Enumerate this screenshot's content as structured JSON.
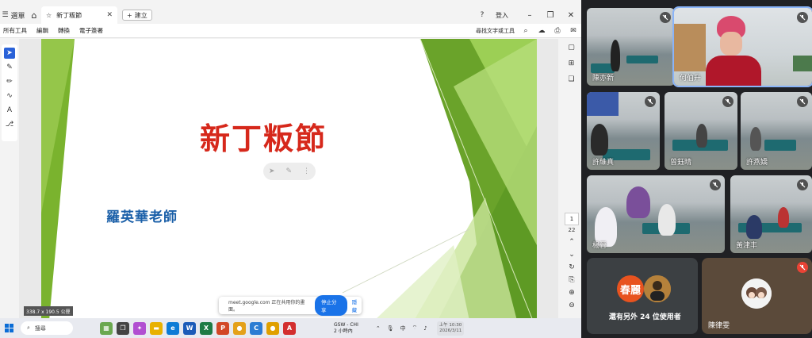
{
  "pdf": {
    "menu_label": "選單",
    "tab_title": "新丁粄節",
    "new_tab_label": "建立",
    "sign_in": "登入",
    "toolbar": {
      "all_tools": "所有工具",
      "edit": "編輯",
      "convert": "轉換",
      "esign": "電子簽署",
      "find_text": "尋找文字或工具"
    },
    "slide": {
      "title": "新丁粄節",
      "subtitle": "羅英華老師"
    },
    "page_current": "1",
    "page_total": "22",
    "dimensions": "338.7 x 190.5 公厘"
  },
  "share": {
    "message": "meet.google.com 正在共用你的畫面。",
    "stop_label": "停止分享",
    "hide_label": "隱藏"
  },
  "taskbar": {
    "search_label": "搜尋",
    "weather_line1": "GSW - CHI",
    "weather_line2": "2 小時內",
    "ime_label": "中",
    "clock_time": "上午 10:30",
    "clock_date": "2026/3/11"
  },
  "meet": {
    "participants": [
      {
        "name": "陳亦新"
      },
      {
        "name": "何伯升"
      },
      {
        "name": "許維真"
      },
      {
        "name": "曾鈺晴"
      },
      {
        "name": "許燕嬌"
      },
      {
        "name": "楊晉"
      },
      {
        "name": "黃津丰"
      }
    ],
    "overflow": {
      "avatar_text": "春麗",
      "label": "還有另外 24 位使用者"
    },
    "self_tile": {
      "name": "陳律雯"
    }
  },
  "colors": {
    "slide_title": "#d6281b",
    "slide_subtitle": "#1a5fa8",
    "accent_green": "#7ab32e",
    "meet_bg": "#202124",
    "share_button": "#1a73e8"
  }
}
